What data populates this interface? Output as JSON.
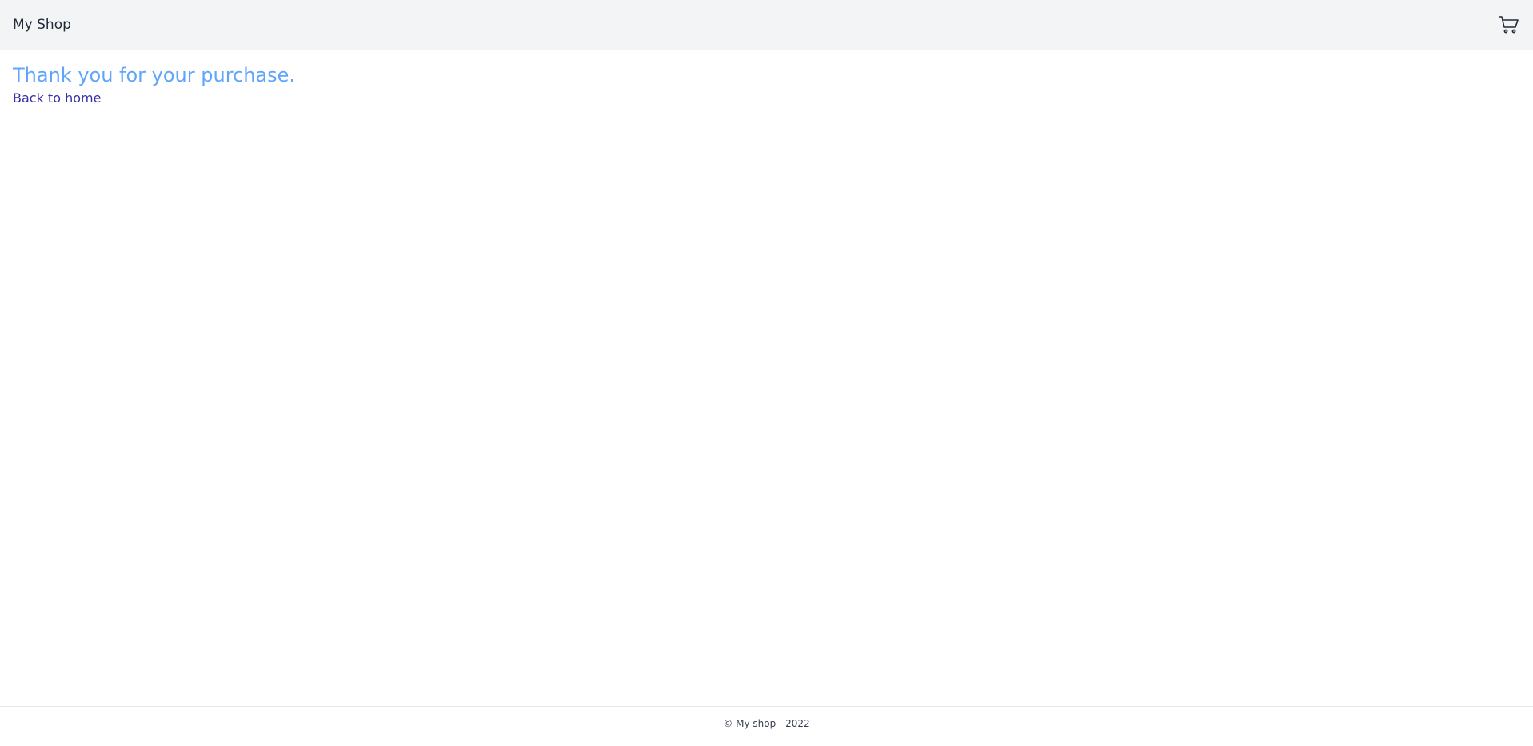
{
  "header": {
    "brand": "My Shop",
    "cart_icon": "shopping-cart-icon"
  },
  "main": {
    "headline": "Thank you for your purchase.",
    "back_link": "Back to home"
  },
  "footer": {
    "copyright": "© My shop - 2022"
  },
  "colors": {
    "header_bg": "#f3f4f6",
    "headline": "#60a5fa",
    "link": "#3730a3"
  }
}
